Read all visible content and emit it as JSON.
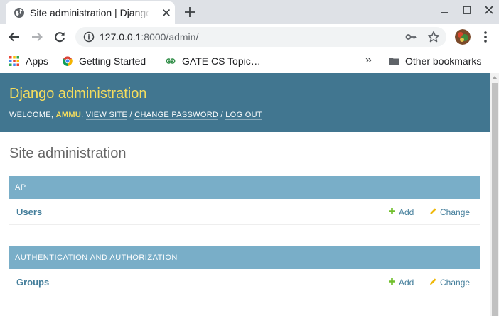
{
  "tab": {
    "title": "Site administration | Django site admin"
  },
  "toolbar": {
    "url_host": "127.0.0.1",
    "url_rest": ":8000/admin/"
  },
  "bookmarks": {
    "items": [
      {
        "label": "Apps",
        "icon": "apps-grid-icon"
      },
      {
        "label": "Getting Started",
        "icon": "chrome-icon"
      },
      {
        "label": "GATE CS Topic…",
        "icon": "geeksforgeeks-icon"
      }
    ],
    "overflow": "»",
    "other": {
      "label": "Other bookmarks",
      "icon": "folder-icon"
    }
  },
  "header": {
    "branding": "Django administration",
    "welcome": "WELCOME,",
    "user": "AMMU",
    "user_suffix": ".",
    "view_site": "VIEW SITE",
    "change_password": "CHANGE PASSWORD",
    "logout": "LOG OUT",
    "separator": "/"
  },
  "content": {
    "title": "Site administration"
  },
  "modules": [
    {
      "caption": "AP",
      "rows": [
        {
          "name": "Users",
          "add": "Add",
          "change": "Change"
        }
      ]
    },
    {
      "caption": "AUTHENTICATION AND AUTHORIZATION",
      "rows": [
        {
          "name": "Groups",
          "add": "Add",
          "change": "Change"
        }
      ]
    }
  ],
  "colors": {
    "header_bg": "#417690",
    "branding": "#f5dd5d",
    "caption_bg": "#79aec8",
    "link": "#447e9b",
    "add_icon": "#70bf2b",
    "change_icon": "#efb80b"
  }
}
